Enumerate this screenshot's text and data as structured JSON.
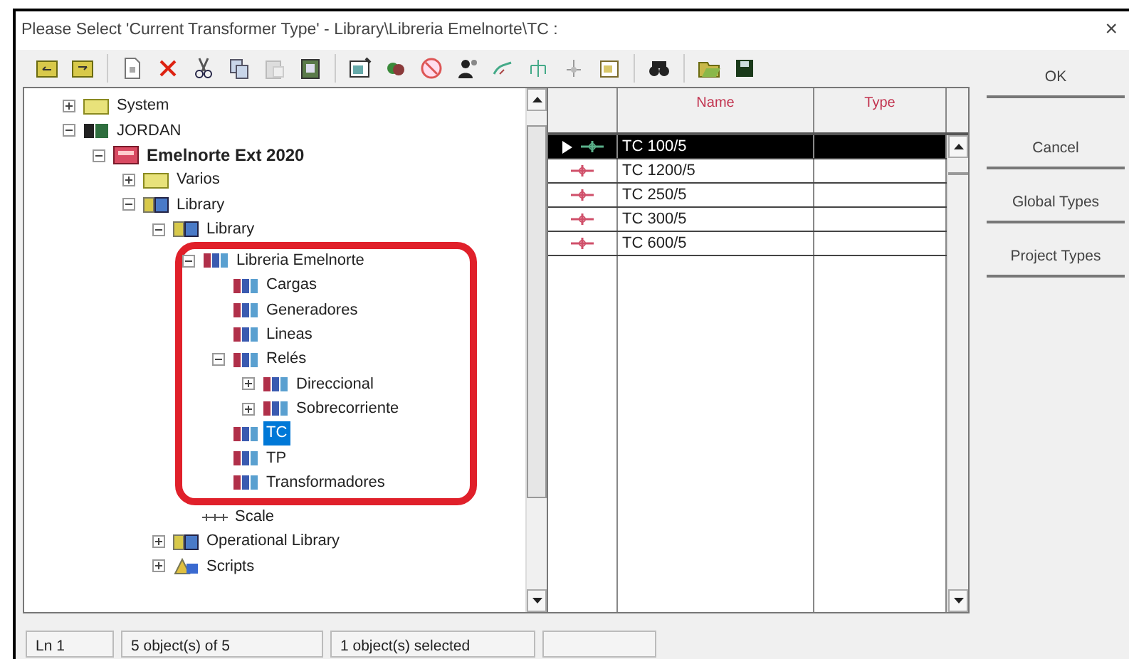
{
  "window": {
    "title": "Please Select 'Current Transformer Type' - Library\\Libreria Emelnorte\\TC :",
    "close": "×"
  },
  "tree": [
    {
      "label": "System",
      "kind": "folder",
      "expanded": false,
      "selected": false
    },
    {
      "label": "JORDAN",
      "kind": "user",
      "expanded": true,
      "selected": false,
      "children": [
        {
          "label": "Emelnorte Ext 2020",
          "kind": "project",
          "active": true,
          "expanded": true,
          "selected": false,
          "children": [
            {
              "label": "Varios",
              "kind": "folder",
              "expanded": false,
              "selected": false
            },
            {
              "label": "Library",
              "kind": "library",
              "expanded": true,
              "selected": false,
              "children": [
                {
                  "label": "Library",
                  "kind": "library",
                  "expanded": true,
                  "selected": false,
                  "children": [
                    {
                      "label": "Libreria Emelnorte",
                      "kind": "book",
                      "expanded": true,
                      "selected": false,
                      "highlighted": true,
                      "children": [
                        {
                          "label": "Cargas",
                          "kind": "book",
                          "selected": false
                        },
                        {
                          "label": "Generadores",
                          "kind": "book",
                          "selected": false
                        },
                        {
                          "label": "Lineas",
                          "kind": "book",
                          "selected": false
                        },
                        {
                          "label": "Relés",
                          "kind": "book",
                          "expanded": true,
                          "selected": false,
                          "children": [
                            {
                              "label": "Direccional",
                              "kind": "book",
                              "expanded": false,
                              "selected": false
                            },
                            {
                              "label": "Sobrecorriente",
                              "kind": "book",
                              "expanded": false,
                              "selected": false
                            }
                          ]
                        },
                        {
                          "label": "TC",
                          "kind": "book",
                          "selected": true
                        },
                        {
                          "label": "TP",
                          "kind": "book",
                          "selected": false
                        },
                        {
                          "label": "Transformadores",
                          "kind": "book",
                          "selected": false
                        }
                      ]
                    },
                    {
                      "label": "Scale",
                      "kind": "scale",
                      "selected": false
                    }
                  ]
                },
                {
                  "label": "Operational Library",
                  "kind": "library",
                  "expanded": false,
                  "selected": false
                },
                {
                  "label": "Scripts",
                  "kind": "scripts",
                  "expanded": false,
                  "selected": false
                }
              ]
            }
          ]
        }
      ]
    }
  ],
  "table": {
    "columns": [
      "Name",
      "Type"
    ],
    "rows": [
      {
        "name": "TC 100/5",
        "selected": true
      },
      {
        "name": "TC 1200/5",
        "selected": false
      },
      {
        "name": "TC 250/5",
        "selected": false
      },
      {
        "name": "TC 300/5",
        "selected": false
      },
      {
        "name": "TC 600/5",
        "selected": false
      }
    ]
  },
  "buttons": [
    "OK",
    "Cancel",
    "Global Types",
    "Project Types"
  ],
  "status_bar": [
    "Ln 1",
    "5 object(s) of 5",
    "1 object(s) selected"
  ]
}
